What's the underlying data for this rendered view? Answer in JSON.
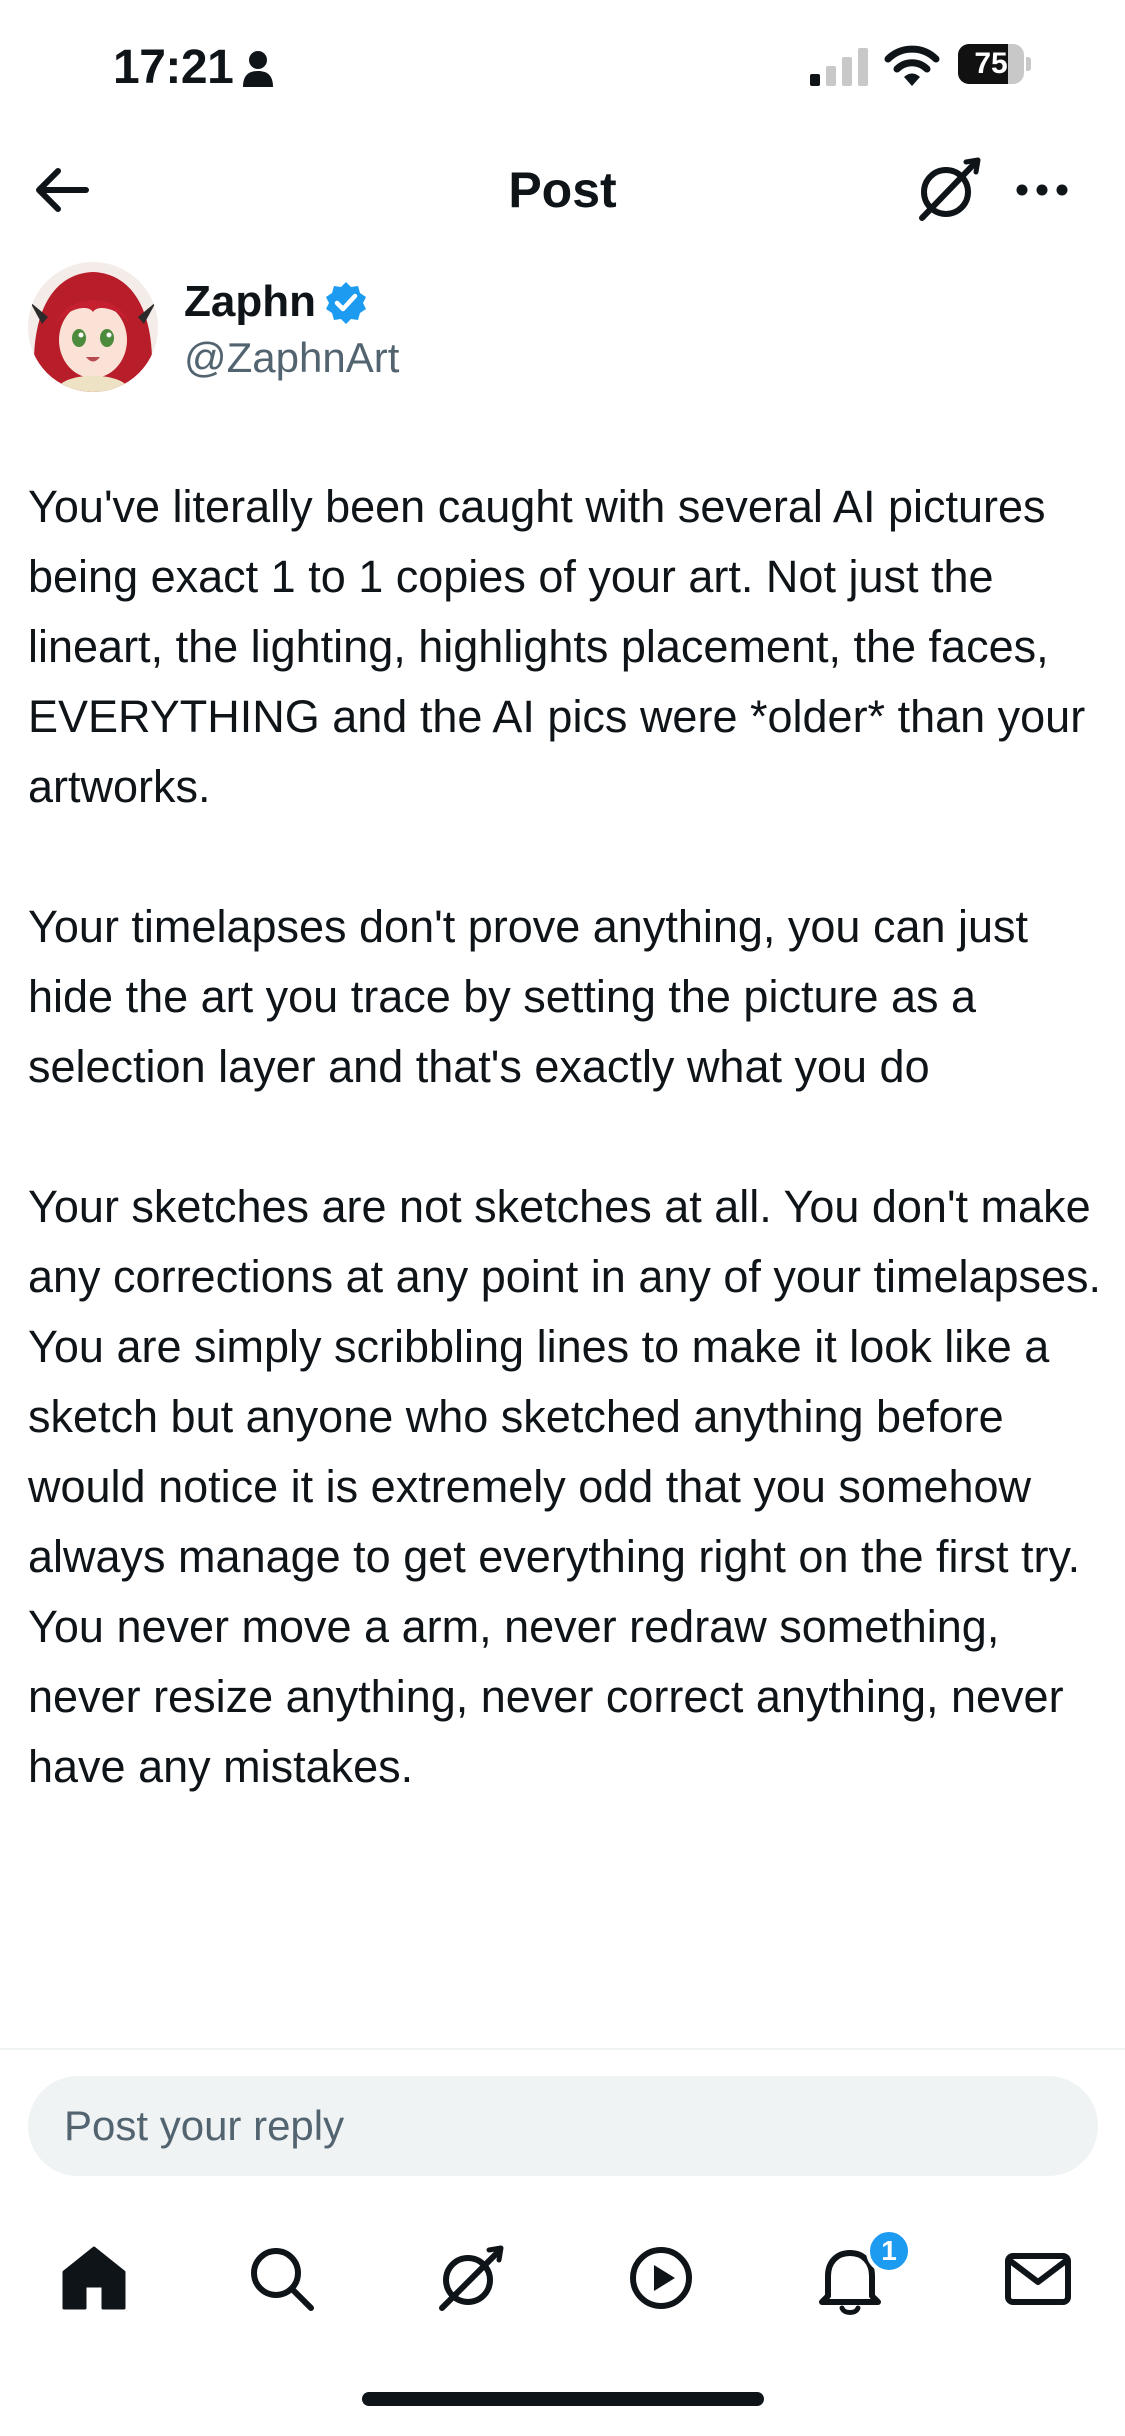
{
  "status_bar": {
    "time": "17:21",
    "battery_level": "75",
    "battery_fraction": 0.75,
    "icons": [
      "person-icon",
      "signal-icon",
      "wifi-icon",
      "battery-icon"
    ]
  },
  "header": {
    "title": "Post",
    "icons": [
      "back-arrow-icon",
      "grok-icon",
      "more-icon"
    ]
  },
  "author": {
    "name": "Zaphn",
    "handle": "@ZaphnArt",
    "verified": true,
    "accent_color": "#1d9bf0"
  },
  "post": {
    "paragraphs": [
      "You've literally been caught with several AI pictures being exact 1 to 1 copies of your art. Not just the lineart, the lighting, highlights placement, the faces, EVERYTHING and the AI pics were *older* than your artworks.",
      "Your timelapses don't prove anything, you can just hide the art you trace by setting the picture as a selection layer and that's exactly what you do",
      "Your sketches are not sketches at all. You don't make any corrections at any point in any of your timelapses.",
      "You are simply scribbling lines to make it look like a sketch but anyone who sketched anything before would notice it is extremely odd that you somehow always manage to get everything right on the first try. You never move a arm, never redraw something, never resize anything, never correct anything, never have any mistakes."
    ]
  },
  "reply": {
    "placeholder": "Post your reply"
  },
  "tab_bar": {
    "tabs": [
      "home-icon",
      "search-icon",
      "grok-icon",
      "video-icon",
      "notifications-icon",
      "messages-icon"
    ],
    "notifications_badge": "1"
  }
}
